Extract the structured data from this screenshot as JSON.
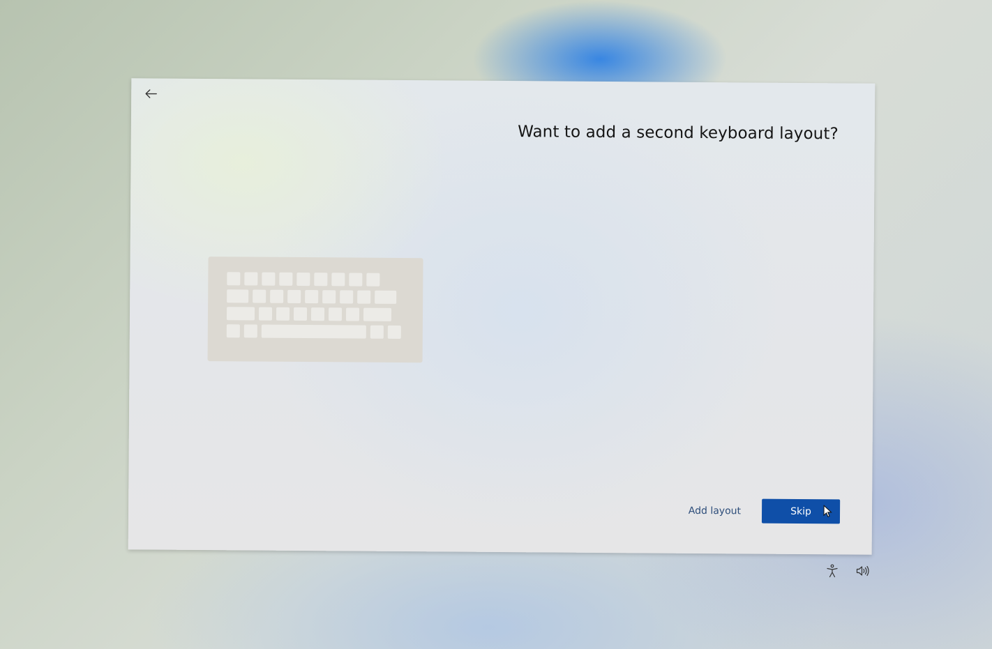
{
  "dialog": {
    "title": "Want to add a second keyboard layout?",
    "back_icon": "back-arrow-icon",
    "illustration": "keyboard-icon"
  },
  "actions": {
    "add_layout_label": "Add layout",
    "skip_label": "Skip"
  },
  "tray": {
    "icons": [
      "accessibility-icon",
      "volume-icon"
    ]
  },
  "colors": {
    "primary": "#0f4fa8",
    "link": "#2d4d7a"
  }
}
